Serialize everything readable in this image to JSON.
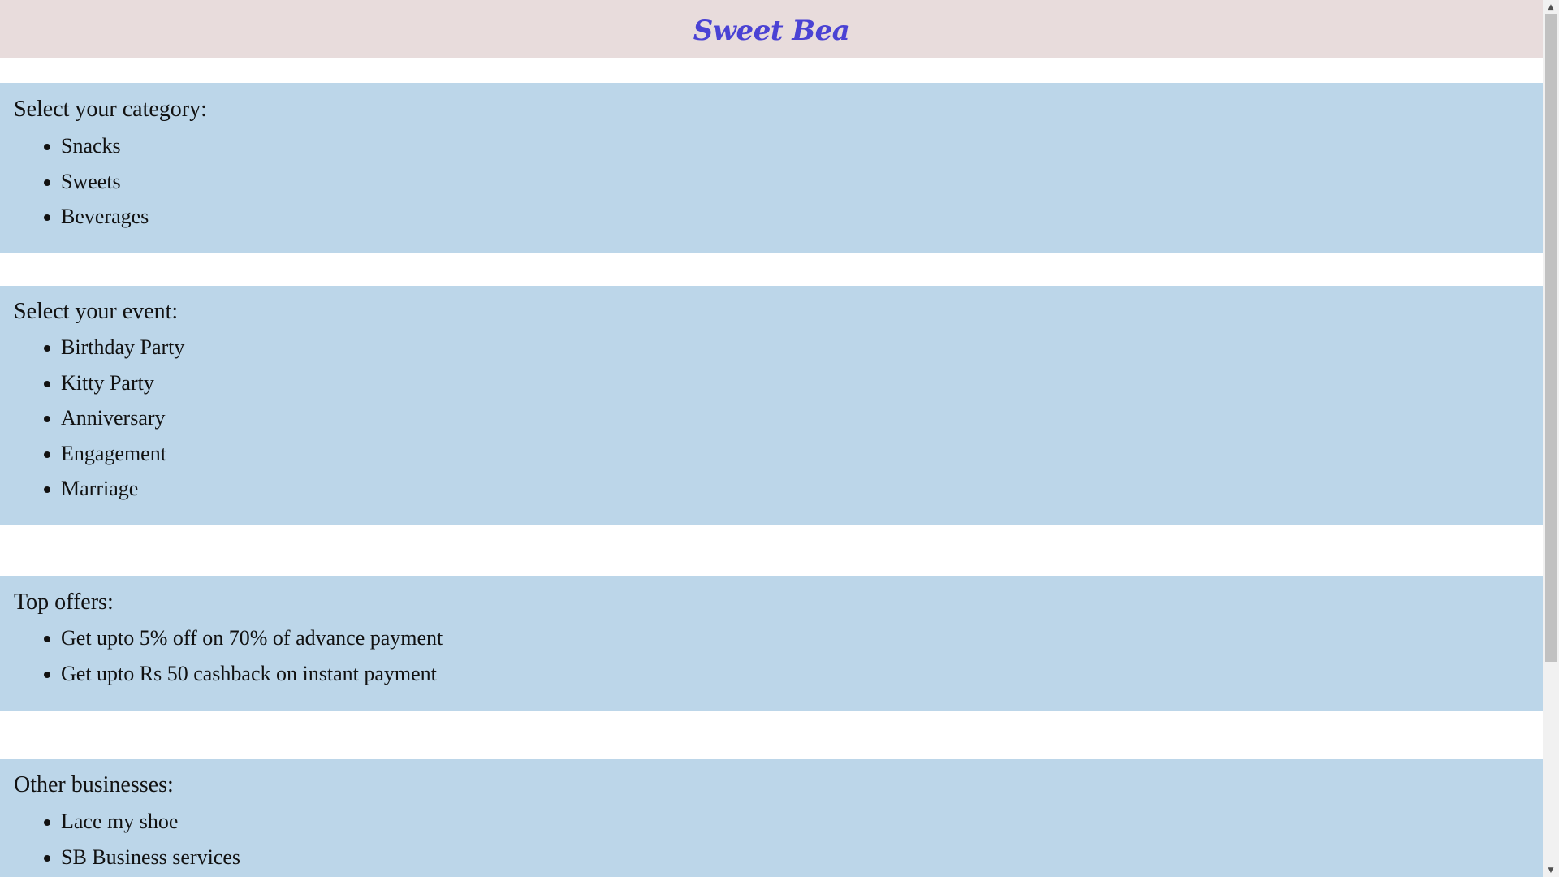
{
  "header": {
    "brand": "Sweet Bea"
  },
  "sections": {
    "category": {
      "title": "Select your category:",
      "items": [
        "Snacks",
        "Sweets",
        "Beverages"
      ]
    },
    "event": {
      "title": "Select your event:",
      "items": [
        "Birthday Party",
        "Kitty Party",
        "Anniversary",
        "Engagement",
        "Marriage"
      ]
    },
    "offers": {
      "title": "Top offers:",
      "items": [
        "Get upto 5% off on 70% of advance payment",
        "Get upto Rs 50 cashback on instant payment"
      ]
    },
    "businesses": {
      "title": "Other businesses:",
      "items": [
        "Lace my shoe",
        "SB Business services"
      ]
    }
  },
  "scrollbar": {
    "up_icon": "scroll-up-arrow-icon",
    "down_icon": "scroll-down-arrow-icon",
    "up_glyph": "▲",
    "down_glyph": "▼"
  },
  "colors": {
    "header_bg": "#e8dcdc",
    "brand": "#4a42d4",
    "section_bg": "#bcd6e9"
  }
}
